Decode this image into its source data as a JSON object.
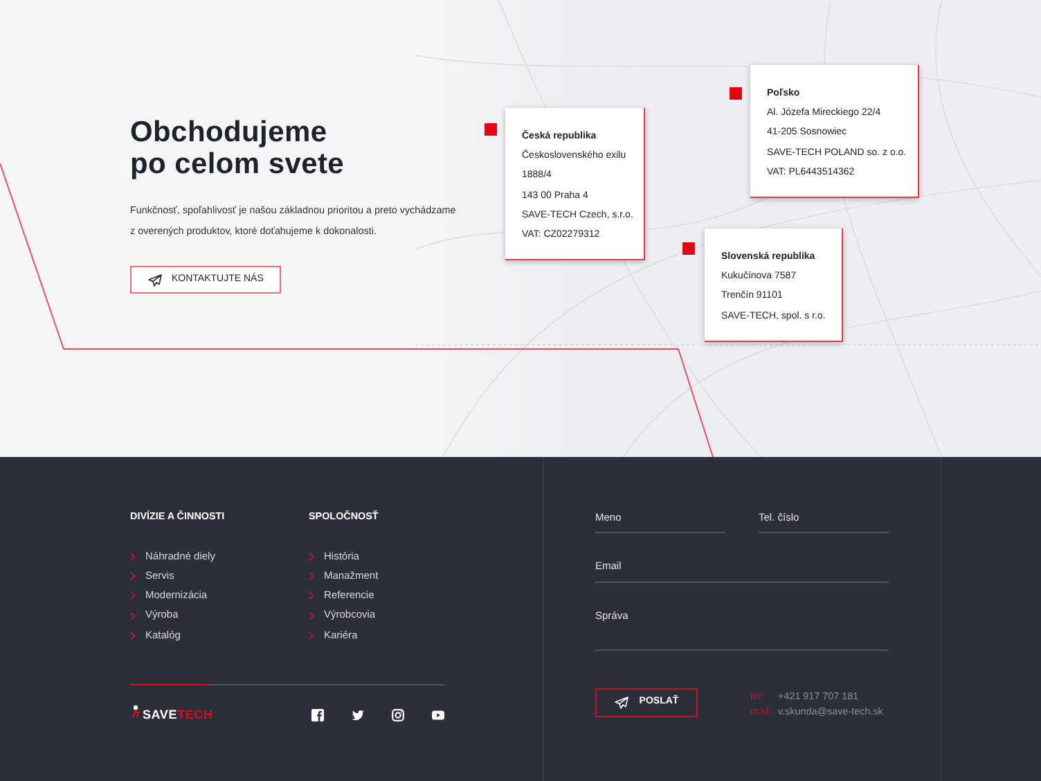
{
  "hero": {
    "title_lines": [
      "Obchodujeme",
      "po celom svete"
    ],
    "description": "Funkčnosť, spoľahlivosť je našou základnou prioritou a preto vychádzame z overených produktov, ktoré doťahujeme k dokonalosti.",
    "button": "KONTAKTUJTE NÁS"
  },
  "offices": [
    {
      "country": "Česká republika",
      "lines": [
        "Československého exilu",
        "1888/4",
        "143 00 Praha 4",
        "SAVE-TECH Czech, s.r.o.",
        "VAT: CZ02279312"
      ]
    },
    {
      "country": "Poľsko",
      "lines": [
        "Al. Józefa Mireckiego 22/4",
        "41-205 Sosnowiec",
        "SAVE-TECH POLAND so. z o.o.",
        "VAT: PL6443514362"
      ]
    },
    {
      "country": "Slovenská republika",
      "lines": [
        "Kukučínova 7587",
        "Trenčín 91101",
        "SAVE-TECH, spol. s r.o."
      ]
    }
  ],
  "footer_columns": [
    {
      "heading": "DIVÍZIE A ČINNOSTI",
      "links": [
        "Náhradné diely",
        "Servis",
        "Modernizácia",
        "Výroba",
        "Katalóg"
      ]
    },
    {
      "heading": "SPOLOČNOSŤ",
      "links": [
        "História",
        "Manažment",
        "Referencie",
        "Výrobcovia",
        "Kariéra"
      ]
    }
  ],
  "logo": [
    "SAVE",
    "TECH"
  ],
  "form": {
    "fields": [
      {
        "placeholder": "Meno",
        "kind": "half"
      },
      {
        "placeholder": "Tel. číslo",
        "kind": "half"
      },
      {
        "placeholder": "Email",
        "kind": "full"
      },
      {
        "placeholder": "Správa",
        "kind": "textarea"
      }
    ],
    "submit": "POSLAŤ",
    "contacts": [
      {
        "label": "tel:",
        "value": "+421 917 707 181"
      },
      {
        "label": "mail:",
        "value": "v.skunda@save-tech.sk"
      }
    ]
  }
}
